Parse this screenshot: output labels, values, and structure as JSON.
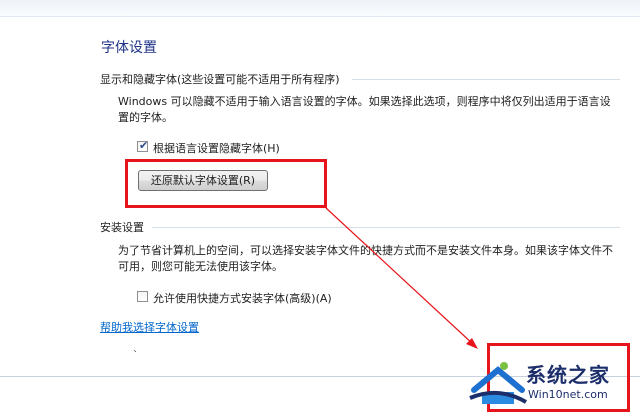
{
  "page": {
    "title": "字体设置",
    "help_link": "帮助我选择字体设置"
  },
  "show_hide": {
    "header": "显示和隐藏字体(这些设置可能不适用于所有程序)",
    "description_line1": "Windows 可以隐藏不适用于输入语言设置的字体。如果选择此选项，则程序中将仅列出适用于语言设",
    "description_line2": "置的字体。",
    "checkbox_label": "根据语言设置隐藏字体(H)",
    "checkbox_checked": true,
    "restore_button": "还原默认字体设置(R)"
  },
  "install": {
    "header": "安装设置",
    "description_line1": "为了节省计算机上的空间，可以选择安装字体文件的快捷方式而不是安装文件本身。如果该字体文件不",
    "description_line2": "可用，则您可能无法使用该字体。",
    "checkbox_label": "允许使用快捷方式安装字体(高级)(A)",
    "checkbox_checked": false
  },
  "watermark": {
    "title": "系统之家",
    "url": "Win10net.com"
  },
  "colors": {
    "highlight": "#e8141b",
    "title": "#1e3287",
    "link": "#0066cc"
  }
}
